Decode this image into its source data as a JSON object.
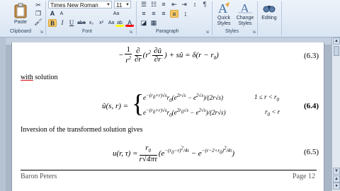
{
  "clipboard": {
    "paste_label": "Paste",
    "group_label": "Clipboard"
  },
  "font": {
    "name": "Times New Roman",
    "size": "11",
    "group_label": "Font",
    "bold": "B",
    "italic": "I",
    "underline": "U",
    "strike": "abe",
    "subscript": "x₂",
    "superscript": "x²",
    "grow": "A",
    "shrink": "A",
    "clear": "Aa",
    "highlight": "ab",
    "color": "A",
    "case": "Aa"
  },
  "paragraph": {
    "group_label": "Paragraph",
    "pilcrow": "¶"
  },
  "styles": {
    "quick_styles_label": "Quick Styles",
    "change_styles_label": "Change Styles",
    "group_label": "Styles"
  },
  "editing": {
    "label": "Editing"
  },
  "doc": {
    "eq_6_3_number": "(6.3)",
    "with_solution_underlined": "with",
    "with_solution_rest": " solution",
    "eq_6_4_number": "(6.4)",
    "case1_cond": "1 ≤ r < r",
    "case1_cond_sub": "0",
    "case2_cond": "r",
    "case2_cond_sub": "0",
    "case2_cond_rest": " < r",
    "inversion_text": "Inversion of the transformed solution gives",
    "eq_6_5_number": "(6.5)",
    "footer_author": "Baron Peters",
    "footer_page": "Page 12"
  },
  "colors": {
    "highlight": "#ffff00",
    "font_color": "#ff0000"
  }
}
